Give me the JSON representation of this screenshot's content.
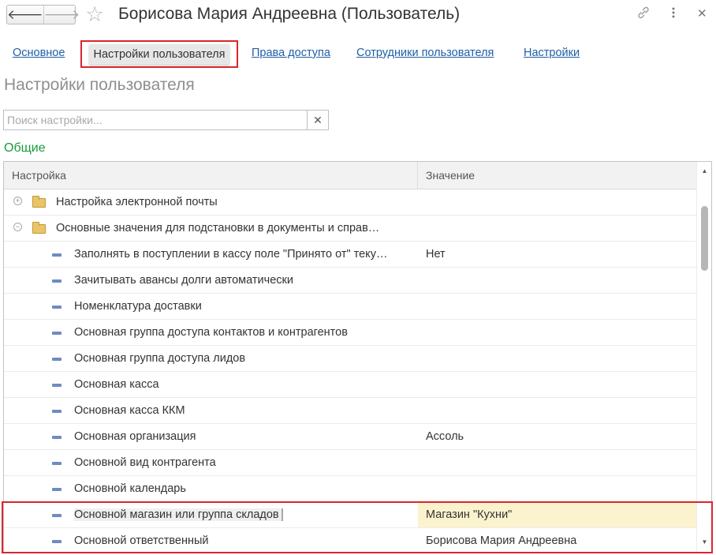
{
  "window": {
    "title": "Борисова Мария Андреевна (Пользователь)",
    "back_icon": "arrow-left-icon",
    "forward_icon": "arrow-right-icon",
    "favorite_icon": "star-icon",
    "link_icon": "link-icon",
    "more_icon": "more-vertical-icon",
    "close_icon": "close-icon"
  },
  "tabs": [
    {
      "label": "Основное",
      "active": false
    },
    {
      "label": "Настройки пользователя",
      "active": true
    },
    {
      "label": "Права доступа",
      "active": false
    },
    {
      "label": "Сотрудники пользователя",
      "active": false
    },
    {
      "label": "Настройки",
      "active": false
    }
  ],
  "section_title": "Настройки пользователя",
  "search": {
    "placeholder": "Поиск настройки...",
    "value": "",
    "clear_icon": "clear-icon"
  },
  "group_title": "Общие",
  "grid": {
    "columns": [
      "Настройка",
      "Значение"
    ],
    "rows": [
      {
        "name": "Настройка электронной почты",
        "value": "",
        "kind": "folder",
        "toggle": "⊕"
      },
      {
        "name": "Основные значения для подстановки в документы и справ…",
        "value": "",
        "kind": "folder",
        "toggle": "⊖"
      },
      {
        "name": "Заполнять в поступлении в кассу поле \"Принято от\" теку…",
        "value": "Нет",
        "kind": "item"
      },
      {
        "name": "Зачитывать авансы долги автоматически",
        "value": "",
        "kind": "item"
      },
      {
        "name": "Номенклатура доставки",
        "value": "",
        "kind": "item"
      },
      {
        "name": "Основная группа доступа контактов и контрагентов",
        "value": "",
        "kind": "item"
      },
      {
        "name": "Основная группа доступа лидов",
        "value": "",
        "kind": "item"
      },
      {
        "name": "Основная касса",
        "value": "",
        "kind": "item"
      },
      {
        "name": "Основная касса ККМ",
        "value": "",
        "kind": "item"
      },
      {
        "name": "Основная организация",
        "value": "Ассоль",
        "kind": "item"
      },
      {
        "name": "Основной вид контрагента",
        "value": "",
        "kind": "item"
      },
      {
        "name": "Основной календарь",
        "value": "",
        "kind": "item"
      },
      {
        "name": "Основной магазин или группа складов",
        "value": "Магазин \"Кухни\"",
        "kind": "item",
        "selected": true
      },
      {
        "name": "Основной ответственный",
        "value": "Борисова Мария Андреевна",
        "kind": "item"
      }
    ]
  },
  "colors": {
    "accent_link": "#1f5fa8",
    "group_title": "#1a9a3a",
    "highlight_frame": "#d9262c",
    "selected_value_bg": "#fbf3cd"
  }
}
